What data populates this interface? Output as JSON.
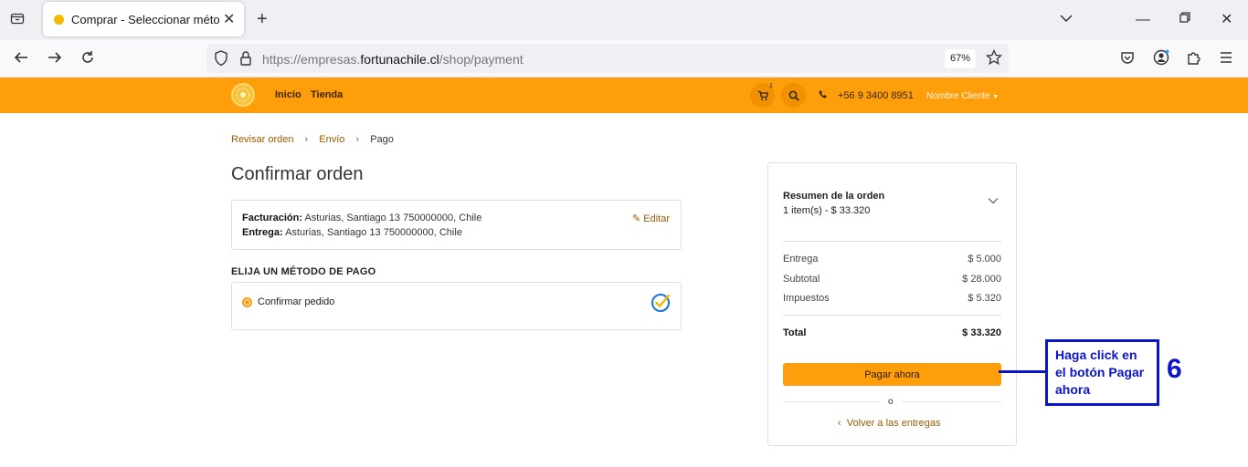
{
  "browser": {
    "tab_title": "Comprar - Seleccionar método",
    "url_prefix": "https://empresas.",
    "url_domain": "fortunachile.cl",
    "url_path": "/shop/payment",
    "zoom": "67%"
  },
  "header": {
    "nav": [
      "Inicio",
      "Tienda"
    ],
    "cart_count": "1",
    "phone": "+56 9 3400 8951",
    "user": "Nombre Cliente"
  },
  "breadcrumb": {
    "items": [
      "Revisar orden",
      "Envío"
    ],
    "current": "Pago"
  },
  "page_title": "Confirmar orden",
  "address": {
    "billing_label": "Facturación:",
    "billing_value": " Asturias, Santiago 13 750000000, Chile",
    "shipping_label": "Entrega:",
    "shipping_value": " Asturias, Santiago 13 750000000, Chile",
    "edit_label": "Editar"
  },
  "payment": {
    "section_label": "ELIJA UN MÉTODO DE PAGO",
    "option_label": "Confirmar pedido"
  },
  "summary": {
    "title": "Resumen de la orden",
    "items": "1 item(s) -  $ 33.320",
    "rows": [
      {
        "label": "Entrega",
        "value": "$ 5.000"
      },
      {
        "label": "Subtotal",
        "value": "$ 28.000"
      },
      {
        "label": "Impuestos",
        "value": "$ 5.320"
      }
    ],
    "total_label": "Total",
    "total_value": "$ 33.320",
    "pay_button": "Pagar ahora",
    "or_text": "o",
    "back_link": "Volver a las entregas"
  },
  "annotation": {
    "text": "Haga click en el botón Pagar ahora",
    "number": "6"
  },
  "colors": {
    "brand": "#ff9e0b",
    "link": "#9a5a00",
    "annotation": "#0a14c8"
  }
}
